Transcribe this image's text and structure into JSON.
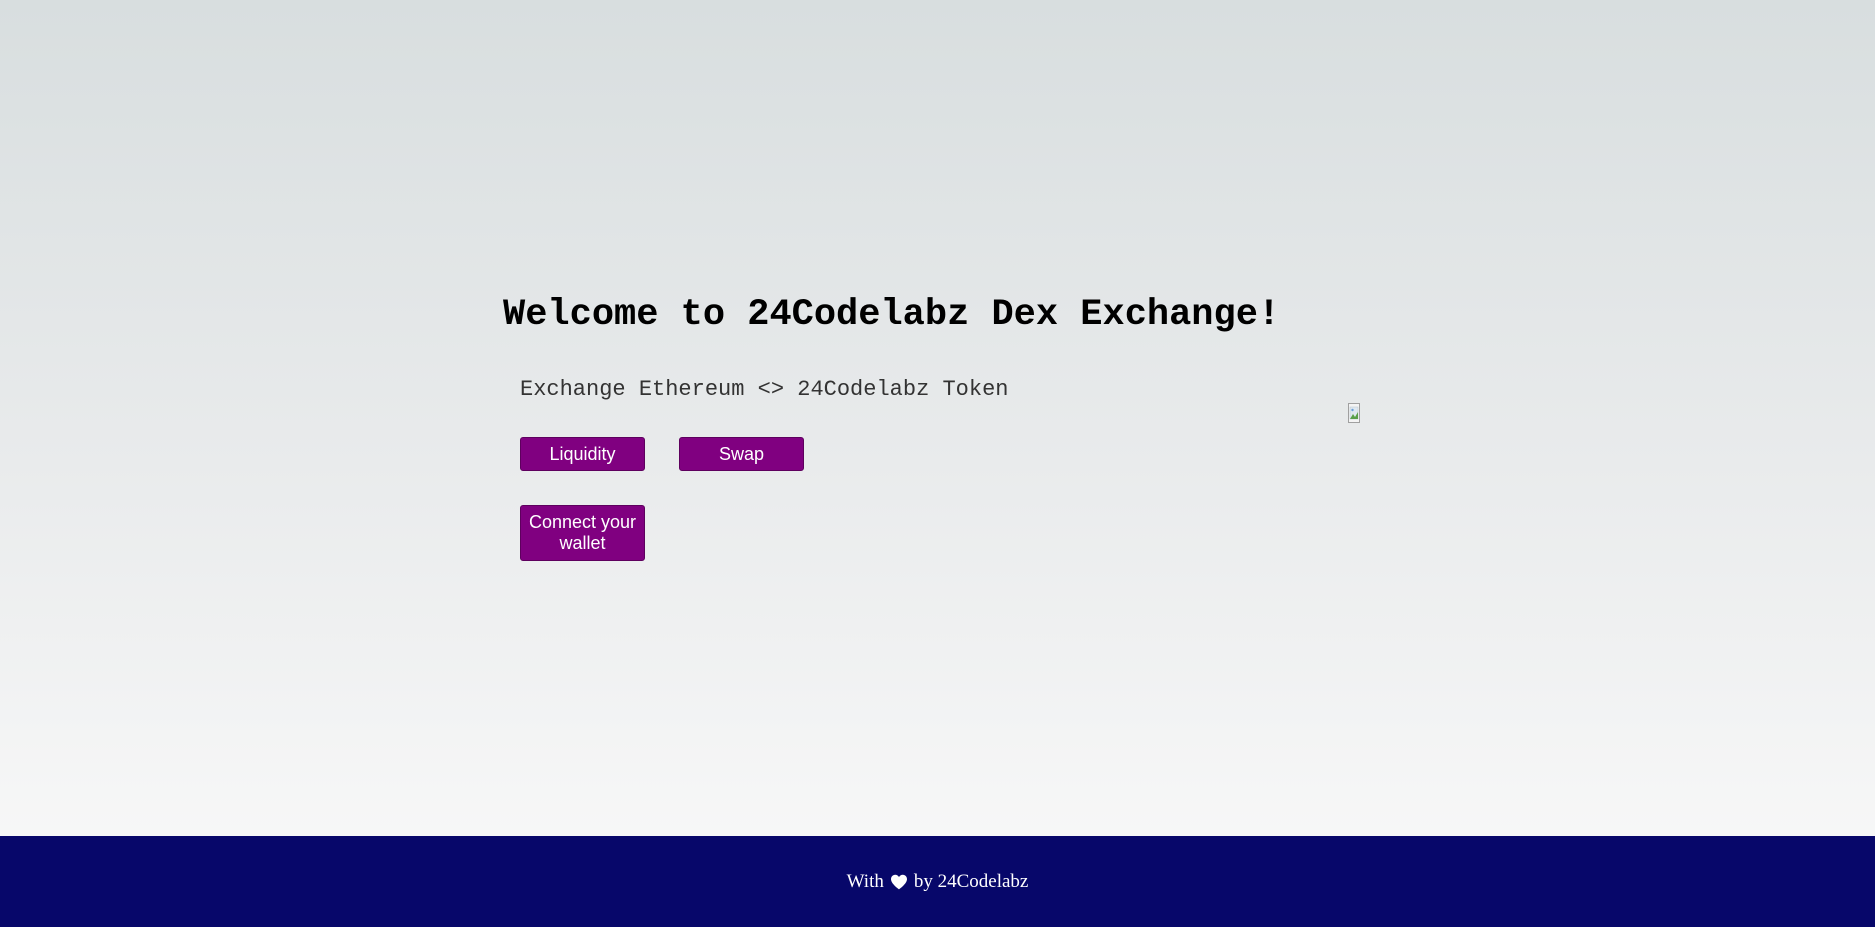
{
  "page": {
    "title": "Welcome to 24Codelabz Dex Exchange!",
    "subtitle": "Exchange Ethereum <> 24Codelabz Token"
  },
  "buttons": {
    "liquidity": "Liquidity",
    "swap": "Swap",
    "connect_wallet": "Connect your wallet"
  },
  "footer": {
    "prefix": "With",
    "icon": "heart-icon",
    "suffix": "by 24Codelabz"
  },
  "colors": {
    "button_bg": "#800080",
    "footer_bg": "#07076a",
    "button_text": "#ffffff"
  }
}
